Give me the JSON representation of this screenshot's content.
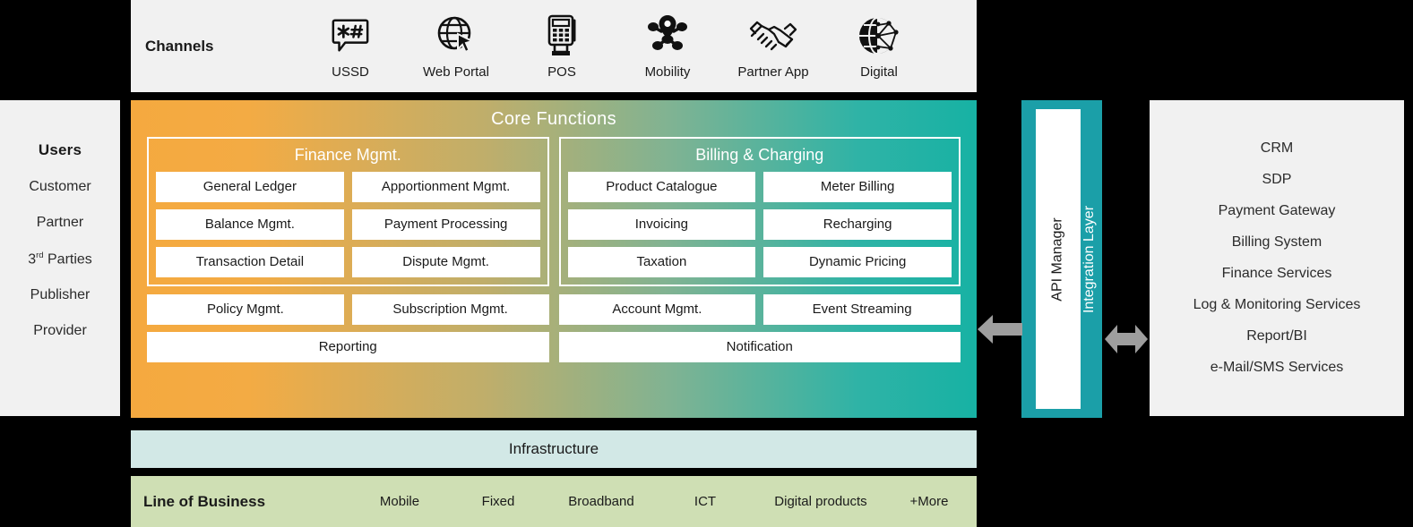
{
  "users": {
    "title": "Users",
    "items": [
      {
        "label": "Customer"
      },
      {
        "label": "Partner"
      },
      {
        "label": "3rd Parties",
        "sup": "rd",
        "base": "3",
        "tail": " Parties"
      },
      {
        "label": "Publisher"
      },
      {
        "label": "Provider"
      }
    ]
  },
  "channels": {
    "title": "Channels",
    "items": [
      {
        "label": "USSD",
        "icon": "ussd-speech-bubble-icon"
      },
      {
        "label": "Web Portal",
        "icon": "globe-cursor-icon"
      },
      {
        "label": "POS",
        "icon": "pos-terminal-icon"
      },
      {
        "label": "Mobility",
        "icon": "map-pin-network-icon"
      },
      {
        "label": "Partner App",
        "icon": "handshake-icon"
      },
      {
        "label": "Digital",
        "icon": "globe-network-icon"
      }
    ]
  },
  "core": {
    "title": "Core Functions",
    "groups": [
      {
        "title": "Finance Mgmt.",
        "rows": [
          [
            "General Ledger",
            "Apportionment Mgmt."
          ],
          [
            "Balance Mgmt.",
            "Payment Processing"
          ],
          [
            "Transaction Detail",
            "Dispute Mgmt."
          ]
        ]
      },
      {
        "title": "Billing & Charging",
        "rows": [
          [
            "Product Catalogue",
            "Meter Billing"
          ],
          [
            "Invoicing",
            "Recharging"
          ],
          [
            "Taxation",
            "Dynamic Pricing"
          ]
        ]
      }
    ],
    "shared": {
      "row1_left": [
        "Policy Mgmt.",
        "Subscription Mgmt."
      ],
      "row1_right": [
        "Account Mgmt.",
        "Event Streaming"
      ],
      "row2_left": [
        "Reporting"
      ],
      "row2_right": [
        "Notification"
      ]
    },
    "gradient_start": "#f5a93f",
    "gradient_end": "#17b2a4"
  },
  "infrastructure": {
    "label": "Infrastructure",
    "color": "#d2e8e6"
  },
  "line_of_business": {
    "title": "Line of Business",
    "items": [
      "Mobile",
      "Fixed",
      "Broadband",
      "ICT",
      "Digital products",
      "+More"
    ],
    "color": "#cfdfb4"
  },
  "integration": {
    "api_manager_label": "API Manager",
    "integration_layer_label": "Integration Layer",
    "color": "#1b9fa8",
    "arrow_color": "#9e9e9e"
  },
  "external": {
    "items": [
      "CRM",
      "SDP",
      "Payment Gateway",
      "Billing System",
      "Finance Services",
      "Log & Monitoring Services",
      "Report/BI",
      "e-Mail/SMS Services"
    ]
  }
}
